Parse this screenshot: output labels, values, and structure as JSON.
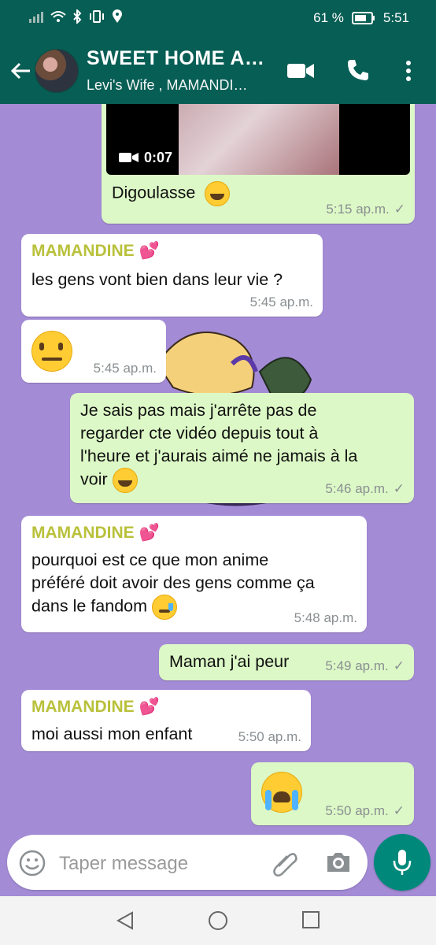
{
  "status_bar": {
    "battery": "61 %",
    "time": "5:51"
  },
  "header": {
    "title": "SWEET HOME A…",
    "subtitle": "Levi's Wife , MAMANDI…"
  },
  "video": {
    "duration": "0:07"
  },
  "messages": [
    {
      "side": "out",
      "text": "Digoulasse",
      "emoji": "grinning-face",
      "time": "5:15 ap.m."
    },
    {
      "side": "in",
      "sender": "MAMANDINE",
      "text": "les gens vont bien dans leur vie ?",
      "time": "5:45 ap.m."
    },
    {
      "side": "in",
      "emoji": "neutral-face",
      "time": "5:45 ap.m."
    },
    {
      "side": "out",
      "lines": [
        "Je sais pas mais j'arrête pas de",
        "regarder cte vidéo depuis tout à",
        "l'heure et j'aurais aimé ne jamais à la",
        "voir"
      ],
      "emoji": "grinning-face",
      "time": "5:46 ap.m."
    },
    {
      "side": "in",
      "sender": "MAMANDINE",
      "lines": [
        "pourquoi est ce que mon anime",
        "préféré doit avoir des gens comme ça",
        "dans le fandom"
      ],
      "emoji": "crying-face",
      "time": "5:48 ap.m."
    },
    {
      "side": "out",
      "text": "Maman j'ai peur",
      "time": "5:49 ap.m."
    },
    {
      "side": "in",
      "sender": "MAMANDINE",
      "text": "moi aussi mon enfant",
      "time": "5:50 ap.m."
    },
    {
      "side": "out",
      "emoji": "loudly-crying-face",
      "time": "5:50 ap.m."
    }
  ],
  "input": {
    "placeholder": "Taper message"
  },
  "colors": {
    "header": "#075e54",
    "chat_bg": "#a48bd6",
    "outgoing_bubble": "#dcf8c6",
    "incoming_bubble": "#ffffff",
    "sender_name": "#b9c13b",
    "mic_button": "#00897b"
  },
  "icons": [
    "back-arrow-icon",
    "video-call-icon",
    "phone-icon",
    "more-vert-icon",
    "emoji-icon",
    "attach-icon",
    "camera-icon",
    "mic-icon",
    "heart-icon",
    "check-icon",
    "nav-back-icon",
    "nav-home-icon",
    "nav-recents-icon"
  ]
}
